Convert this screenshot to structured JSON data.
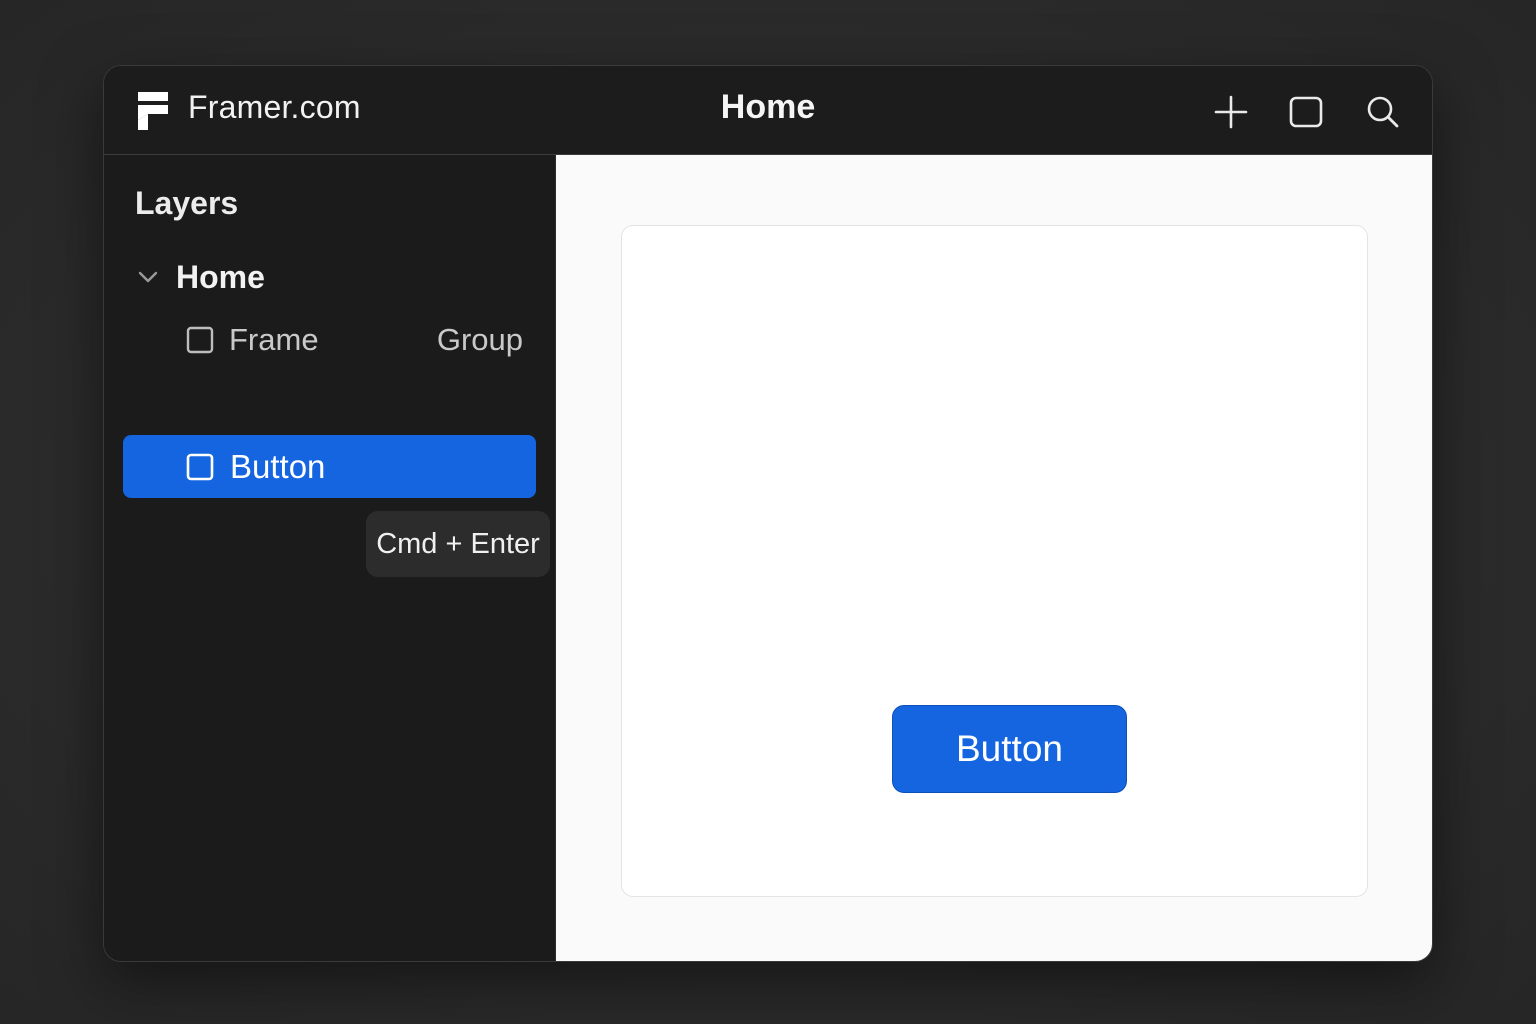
{
  "app": {
    "brand": "Framer.com",
    "page_title": "Home"
  },
  "toolbar": {
    "icons": [
      "plus-icon",
      "frame-icon",
      "search-icon"
    ]
  },
  "sidebar": {
    "title": "Layers",
    "tree": {
      "root_label": "Home",
      "frame_row": {
        "label": "Frame",
        "secondary": "Group"
      },
      "button_row": {
        "label": "Button",
        "selected": true
      }
    },
    "shortcut_hint": "Cmd + Enter"
  },
  "canvas": {
    "button_label": "Button"
  },
  "colors": {
    "accent": "#1565e0",
    "window_bg": "#1b1b1b",
    "canvas_bg": "#fafafa"
  }
}
